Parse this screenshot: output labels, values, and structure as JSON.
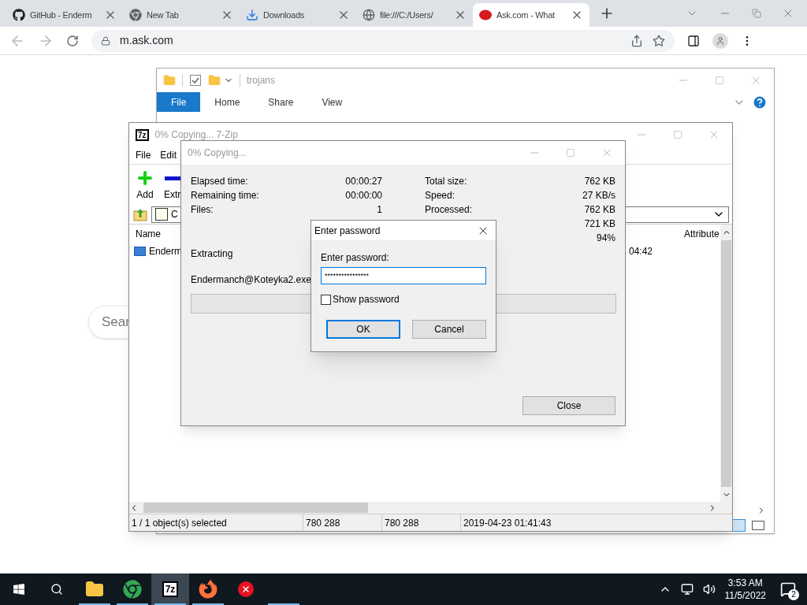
{
  "browser": {
    "tabs": [
      {
        "title": "GitHub - Enderm",
        "kind": "github",
        "selected": false
      },
      {
        "title": "New Tab",
        "kind": "chrome",
        "selected": false
      },
      {
        "title": "Downloads",
        "kind": "download",
        "selected": false
      },
      {
        "title": "file:///C:/Users/",
        "kind": "globe",
        "selected": false
      },
      {
        "title": "Ask.com - What",
        "kind": "ask",
        "selected": true
      }
    ],
    "url": "m.ask.com",
    "search_placeholder": "Sear"
  },
  "explorer": {
    "title": "trojans",
    "ribbon_tabs": [
      {
        "label": "File",
        "selected": true
      },
      {
        "label": "Home",
        "selected": false
      },
      {
        "label": "Share",
        "selected": false
      },
      {
        "label": "View",
        "selected": false
      }
    ]
  },
  "sevenzip": {
    "title": "0% Copying... 7-Zip",
    "menu": [
      "File",
      "Edit"
    ],
    "toolbar": [
      {
        "label": "Add",
        "kind": "add"
      },
      {
        "label": "Extr",
        "kind": "extract"
      }
    ],
    "path": "C",
    "columns": [
      "Name",
      "Attribute"
    ],
    "rows": [
      {
        "name": "Enderm",
        "column_2": "04:42"
      }
    ],
    "status": [
      "1 / 1 object(s) selected",
      "780 288",
      "780 288",
      "2019-04-23 01:41:43"
    ]
  },
  "progress": {
    "title": "0% Copying...",
    "left": [
      {
        "label": "Elapsed time:",
        "value": "00:00:27"
      },
      {
        "label": "Remaining time:",
        "value": "00:00:00"
      },
      {
        "label": "Files:",
        "value": "1"
      }
    ],
    "right": [
      {
        "label": "Total size:",
        "value": "762 KB"
      },
      {
        "label": "Speed:",
        "value": "27 KB/s"
      },
      {
        "label": "Processed:",
        "value": "762 KB"
      },
      {
        "value": "721 KB"
      },
      {
        "value": "94%"
      }
    ],
    "action": "Extracting",
    "file": "Endermanch@Koteyka2.exe",
    "level": 0,
    "close": "Close"
  },
  "password": {
    "title": "Enter password",
    "label": "Enter password:",
    "value": "****************",
    "show_password": {
      "label": "Show password",
      "checked": false
    },
    "ok": "OK",
    "cancel": "Cancel"
  },
  "taskbar": {
    "apps": [
      {
        "kind": "folder",
        "running": true,
        "selected": false
      },
      {
        "kind": "chrome",
        "running": true,
        "selected": false
      },
      {
        "kind": "7z",
        "label": "7z",
        "running": true,
        "selected": true
      },
      {
        "kind": "firefox",
        "running": true,
        "selected": false
      },
      {
        "kind": "error",
        "running": false,
        "selected": false
      },
      {
        "kind": "blank",
        "running": true,
        "selected": false
      }
    ],
    "time": "3:53 AM",
    "date": "11/5/2022",
    "notifications": "2"
  }
}
